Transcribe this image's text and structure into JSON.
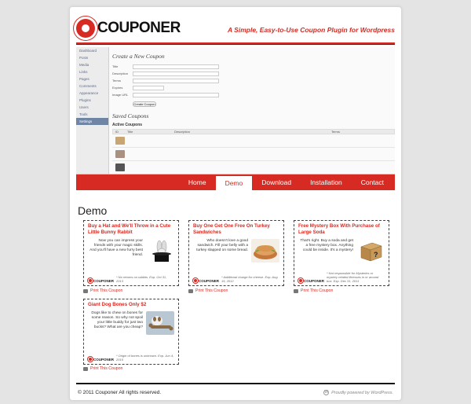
{
  "header": {
    "logo": "COUPONER",
    "tagline": "A Simple, Easy-to-Use Coupon Plugin for Wordpress"
  },
  "screenshot": {
    "sidebar": [
      "Dashboard",
      "Posts",
      "Media",
      "Links",
      "Pages",
      "Comments",
      "Appearance",
      "Plugins",
      "Users",
      "Tools",
      "Settings"
    ],
    "heading": "Create a New Coupon",
    "fields": [
      "Title",
      "Description",
      "Terms",
      "Expires",
      "Image URL"
    ],
    "button": "Create Coupon",
    "saved_heading": "Saved Coupons",
    "active_label": "Active Coupons",
    "cols": [
      "ID",
      "Title",
      "Description",
      "Terms"
    ]
  },
  "nav": {
    "items": [
      "Home",
      "Demo",
      "Download",
      "Installation",
      "Contact"
    ],
    "active": "Demo"
  },
  "page_title": "Demo",
  "coupons": [
    {
      "title": "Buy a Hat and We'll Throw in a Cute Little Bunny Rabbit",
      "text": "Now you can impress your friends with your magic skills. And you'll have a new furry best friend.",
      "fine": "* No returns on rabbits. Exp. Oct 31, 2013",
      "print": "Print This Coupon"
    },
    {
      "title": "Buy One Get One Free On Turkey Sandwiches",
      "text": "Who doesn't love a good sandwich. Fill your belly with a turkey slapped on some bread.",
      "fine": "* Additional charge for cheese. Exp. Aug 15, 2012",
      "print": "Print This Coupon"
    },
    {
      "title": "Free Mystery Box With Purchase of Large Soda",
      "text": "That's right. Buy a soda and get a free mystery box. Anything could be inside. It's a mystery!",
      "fine": "* Not responsible for Mysteries or mystery related illnesses in or around box. Exp. Dec 31, 2011",
      "print": "Print This Coupon"
    },
    {
      "title": "Giant Dog Bones Only $2",
      "text": "Dogs like to chew on bones for some reason. So why not spoil your little buddy for just two bucks? What are you cheap?",
      "fine": "* Origin of bones is unknown. Exp. Jun 4, 2015",
      "print": "Print This Coupon"
    }
  ],
  "coupon_logo": "COUPONER",
  "footer": {
    "copyright": "© 2011 Couponer All rights reserved.",
    "powered": "Proudly powered by WordPress."
  }
}
